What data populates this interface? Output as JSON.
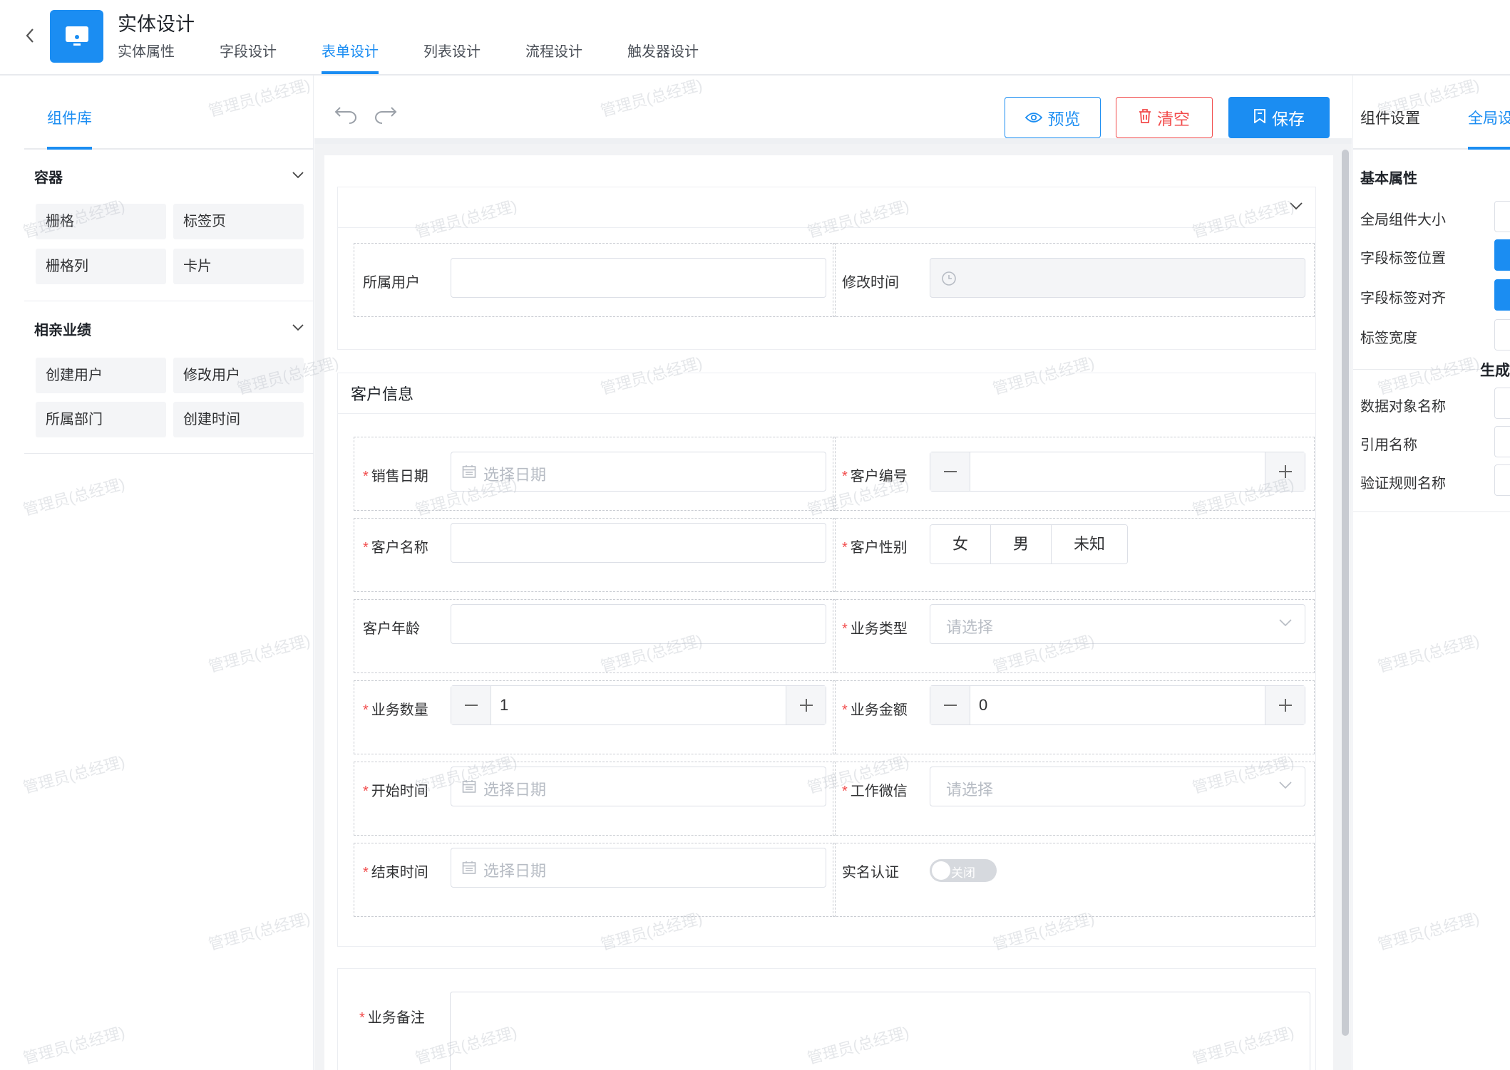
{
  "header": {
    "title": "实体设计",
    "tabs": [
      {
        "label": "实体属性",
        "active": false
      },
      {
        "label": "字段设计",
        "active": false
      },
      {
        "label": "表单设计",
        "active": true
      },
      {
        "label": "列表设计",
        "active": false
      },
      {
        "label": "流程设计",
        "active": false
      },
      {
        "label": "触发器设计",
        "active": false
      }
    ]
  },
  "library": {
    "tab_label": "组件库",
    "groups": [
      {
        "title": "容器",
        "items": [
          "栅格",
          "标签页",
          "栅格列",
          "卡片"
        ]
      },
      {
        "title": "相亲业绩",
        "items": [
          "创建用户",
          "修改用户",
          "所属部门",
          "创建时间"
        ]
      }
    ]
  },
  "toolbar": {
    "preview_label": "预览",
    "clear_label": "清空",
    "save_label": "保存"
  },
  "form": {
    "top_section": {
      "fields": [
        {
          "label": "所属用户",
          "required": false,
          "value": ""
        },
        {
          "label": "修改时间",
          "required": false,
          "value": ""
        }
      ]
    },
    "customer_section": {
      "title": "客户信息",
      "fields": {
        "sales_date": {
          "label": "销售日期",
          "placeholder": "选择日期"
        },
        "customer_no": {
          "label": "客户编号",
          "value": ""
        },
        "customer_name": {
          "label": "客户名称",
          "value": ""
        },
        "customer_gender": {
          "label": "客户性别",
          "options": [
            "女",
            "男",
            "未知"
          ]
        },
        "customer_age": {
          "label": "客户年龄",
          "value": ""
        },
        "business_type": {
          "label": "业务类型",
          "placeholder": "请选择"
        },
        "business_qty": {
          "label": "业务数量",
          "value": "1"
        },
        "business_amount": {
          "label": "业务金额",
          "value": "0"
        },
        "start_time": {
          "label": "开始时间",
          "placeholder": "选择日期"
        },
        "work_wechat": {
          "label": "工作微信",
          "placeholder": "请选择"
        },
        "end_time": {
          "label": "结束时间",
          "placeholder": "选择日期"
        },
        "realname_auth": {
          "label": "实名认证",
          "switch_text": "关闭"
        }
      }
    },
    "notes_section": {
      "field": {
        "label": "业务备注",
        "value": ""
      }
    }
  },
  "settings": {
    "tabs": [
      {
        "label": "组件设置",
        "active": false
      },
      {
        "label": "全局设",
        "active": true
      }
    ],
    "basic_title": "基本属性",
    "basic_labels": [
      "全局组件大小",
      "字段标签位置",
      "字段标签对齐",
      "标签宽度"
    ],
    "generate_title": "生成",
    "generate_labels": [
      "数据对象名称",
      "引用名称",
      "验证规则名称"
    ]
  },
  "watermark": "管理员(总经理)",
  "colors": {
    "primary": "#1b8df2",
    "danger": "#f24b4b",
    "required": "#f24b4b"
  }
}
